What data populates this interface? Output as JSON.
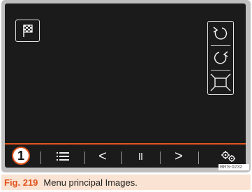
{
  "screen": {
    "top_buttons": {
      "flag_icon": "checkered-flag-icon",
      "rotate_left_icon": "rotate-left-icon",
      "rotate_right_icon": "rotate-right-icon",
      "fit_icon": "fit-screen-icon"
    },
    "bottom_bar": {
      "callout_number": "1",
      "list_icon": "list-icon",
      "prev_label": "<",
      "pause_label": "II",
      "next_label": ">",
      "settings_icon": "gears-icon"
    },
    "accent_color": "#e2541e"
  },
  "figure": {
    "reference_code": "BRS-0232",
    "caption_number": "Fig. 219",
    "caption_text": "Menu principal Images."
  }
}
